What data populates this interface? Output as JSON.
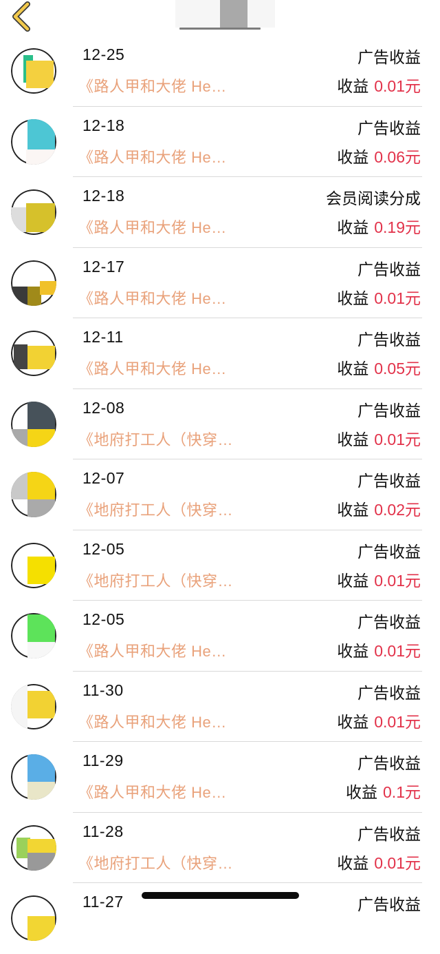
{
  "header": {
    "back_icon": "chevron-left-icon",
    "accent": "#f2c94c"
  },
  "colors": {
    "book": "#e9a27b",
    "amount": "#e2324a",
    "text": "#111111"
  },
  "income_prefix": "收益",
  "rows": [
    {
      "date": "12-25",
      "type": "广告收益",
      "book": "《路人甲和大佬 He…",
      "amount": "0.01元"
    },
    {
      "date": "12-18",
      "type": "广告收益",
      "book": "《路人甲和大佬 He…",
      "amount": "0.06元"
    },
    {
      "date": "12-18",
      "type": "会员阅读分成",
      "book": "《路人甲和大佬 He…",
      "amount": "0.19元"
    },
    {
      "date": "12-17",
      "type": "广告收益",
      "book": "《路人甲和大佬 He…",
      "amount": "0.01元"
    },
    {
      "date": "12-11",
      "type": "广告收益",
      "book": "《路人甲和大佬 He…",
      "amount": "0.05元"
    },
    {
      "date": "12-08",
      "type": "广告收益",
      "book": "《地府打工人（快穿…",
      "amount": "0.01元"
    },
    {
      "date": "12-07",
      "type": "广告收益",
      "book": "《地府打工人（快穿…",
      "amount": "0.02元"
    },
    {
      "date": "12-05",
      "type": "广告收益",
      "book": "《地府打工人（快穿…",
      "amount": "0.01元"
    },
    {
      "date": "12-05",
      "type": "广告收益",
      "book": "《路人甲和大佬 He…",
      "amount": "0.01元"
    },
    {
      "date": "11-30",
      "type": "广告收益",
      "book": "《路人甲和大佬 He…",
      "amount": "0.01元"
    },
    {
      "date": "11-29",
      "type": "广告收益",
      "book": "《路人甲和大佬 He…",
      "amount": "0.1元"
    },
    {
      "date": "11-28",
      "type": "广告收益",
      "book": "《地府打工人（快穿…",
      "amount": "0.01元"
    },
    {
      "date": "11-27",
      "type": "广告收益",
      "book": "",
      "amount": ""
    }
  ]
}
